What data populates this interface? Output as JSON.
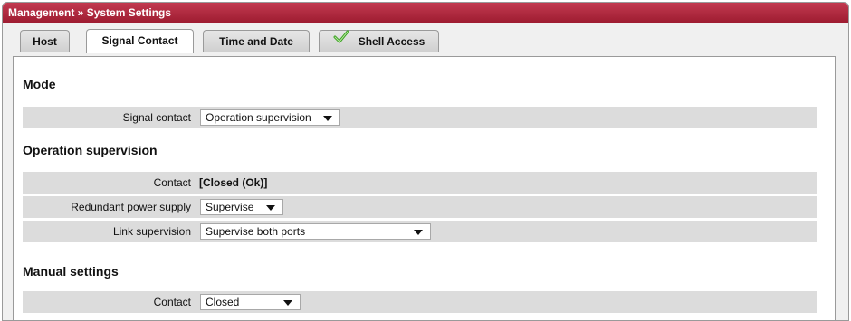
{
  "titlebar": {
    "title": "Management » System Settings"
  },
  "tabs": [
    {
      "label": "Host"
    },
    {
      "label": "Signal Contact"
    },
    {
      "label": "Time and Date"
    },
    {
      "label": "Shell Access"
    }
  ],
  "sections": {
    "mode": {
      "title": "Mode"
    },
    "operation": {
      "title": "Operation supervision"
    },
    "manual": {
      "title": "Manual settings"
    }
  },
  "fields": {
    "signal_contact": {
      "label": "Signal contact",
      "value": "Operation supervision"
    },
    "contact_status": {
      "label": "Contact",
      "value": "[Closed (Ok)]"
    },
    "redundant_power": {
      "label": "Redundant power supply",
      "value": "Supervise"
    },
    "link_supervision": {
      "label": "Link supervision",
      "value": "Supervise both ports"
    },
    "manual_contact": {
      "label": "Contact",
      "value": "Closed"
    }
  },
  "colors": {
    "titlebar": "#b02a40",
    "check": "#3aa020"
  },
  "icons": {
    "shell_access_status": "check-icon"
  }
}
